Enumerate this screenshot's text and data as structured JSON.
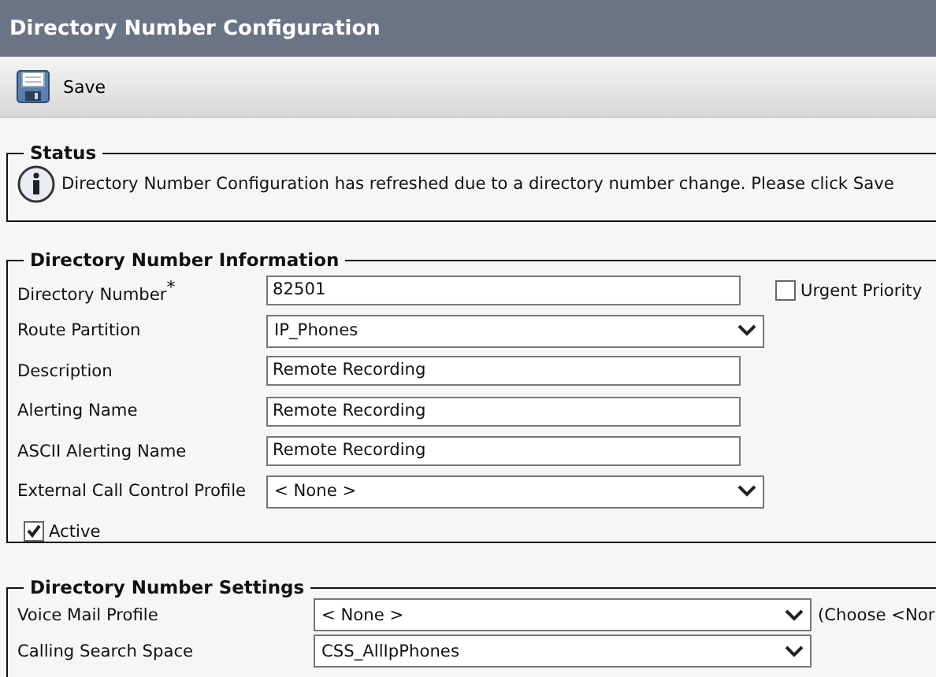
{
  "window": {
    "title": "Directory Number Configuration"
  },
  "toolbar": [
    {
      "label": "Save"
    }
  ],
  "status": {
    "legend": "Status",
    "message": "Directory Number Configuration has refreshed due to a directory number change. Please click Save"
  },
  "information": {
    "legend": "Directory Number Information",
    "fields": [
      {
        "label": "Directory Number",
        "required_mark": "*",
        "kind": "text",
        "value": "82501"
      },
      {
        "label": "Route Partition",
        "kind": "select",
        "value": "IP_Phones"
      },
      {
        "label": "Description",
        "kind": "text",
        "value": "Remote Recording"
      },
      {
        "label": "Alerting Name",
        "kind": "text",
        "value": "Remote Recording"
      },
      {
        "label": "ASCII Alerting Name",
        "kind": "text",
        "value": "Remote Recording"
      },
      {
        "label": "External Call Control Profile",
        "kind": "select",
        "value": "< None >"
      }
    ],
    "urgent_priority": {
      "label": "Urgent Priority",
      "checked": false
    },
    "active": {
      "label": "Active",
      "checked": true
    }
  },
  "settings": {
    "legend": "Directory Number Settings",
    "fields": [
      {
        "label": "Voice Mail Profile",
        "kind": "select",
        "value": "< None >",
        "note": "(Choose <Nor"
      },
      {
        "label": "Calling Search Space",
        "kind": "select",
        "value": "CSS_AllIpPhones"
      }
    ]
  }
}
